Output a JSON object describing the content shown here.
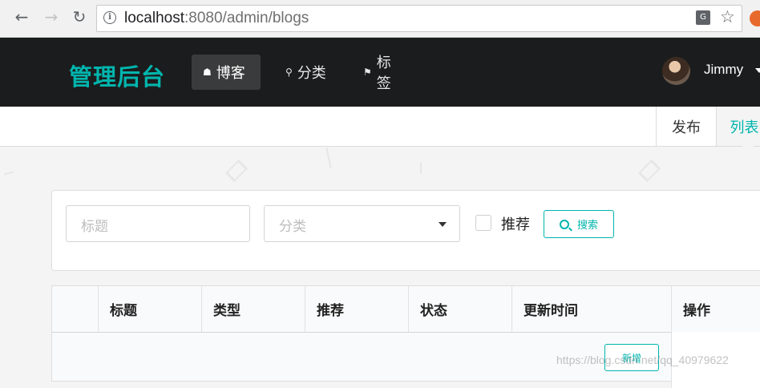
{
  "browser": {
    "url_host": "localhost",
    "url_rest": ":8080/admin/blogs",
    "translate_icon": "translate-icon",
    "bookmark_icon": "star-icon"
  },
  "navbar": {
    "brand": "管理后台",
    "menu": [
      {
        "label": "博客",
        "icon": "home-icon",
        "active": true
      },
      {
        "label": "分类",
        "icon": "lightbulb-icon",
        "active": false
      },
      {
        "label": "标签",
        "icon": "tag-icon",
        "active": false
      }
    ],
    "user": {
      "name": "Jimmy"
    }
  },
  "subnav": {
    "publish": "发布",
    "list": "列表"
  },
  "filter": {
    "title_placeholder": "标题",
    "category_placeholder": "分类",
    "recommend_label": "推荐",
    "search_button": "搜索"
  },
  "table": {
    "headers": [
      "",
      "标题",
      "类型",
      "推荐",
      "状态",
      "更新时间",
      "操作"
    ],
    "new_button": "新增"
  },
  "watermark": "https://blog.csdn.net/qq_40979622",
  "colors": {
    "accent": "#00b5ad",
    "navbar_bg": "#1b1c1d"
  }
}
